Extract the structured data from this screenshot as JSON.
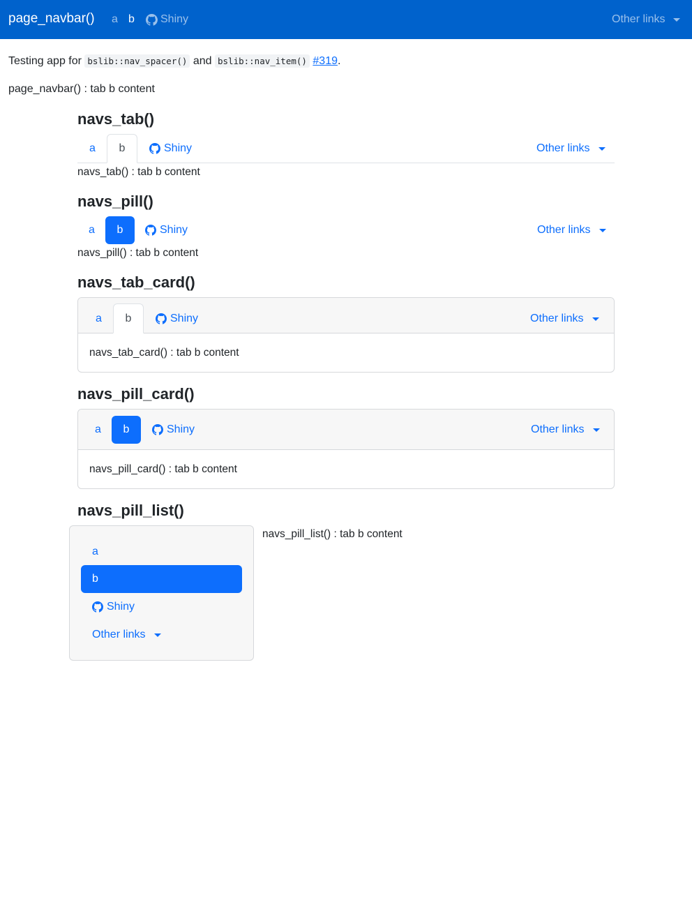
{
  "navbar": {
    "title": "page_navbar()",
    "items": [
      "a",
      "b"
    ],
    "shiny_label": "Shiny",
    "other_links": "Other links"
  },
  "intro": {
    "prefix": "Testing app for ",
    "code1": "bslib::nav_spacer()",
    "and": " and ",
    "code2": "bslib::nav_item()",
    "issue": "#319",
    "suffix": "."
  },
  "page_content": "page_navbar() : tab b content",
  "sections": {
    "tab": {
      "heading": "navs_tab()",
      "items": [
        "a",
        "b"
      ],
      "shiny_label": "Shiny",
      "other_links": "Other links",
      "content": "navs_tab() : tab b content"
    },
    "pill": {
      "heading": "navs_pill()",
      "items": [
        "a",
        "b"
      ],
      "shiny_label": "Shiny",
      "other_links": "Other links",
      "content": "navs_pill() : tab b content"
    },
    "tab_card": {
      "heading": "navs_tab_card()",
      "items": [
        "a",
        "b"
      ],
      "shiny_label": "Shiny",
      "other_links": "Other links",
      "content": "navs_tab_card() : tab b content"
    },
    "pill_card": {
      "heading": "navs_pill_card()",
      "items": [
        "a",
        "b"
      ],
      "shiny_label": "Shiny",
      "other_links": "Other links",
      "content": "navs_pill_card() : tab b content"
    },
    "pill_list": {
      "heading": "navs_pill_list()",
      "items": [
        "a",
        "b"
      ],
      "shiny_label": "Shiny",
      "other_links": "Other links",
      "content": "navs_pill_list() : tab b content"
    }
  },
  "colors": {
    "navbar_bg": "#0062cc",
    "accent": "#0d6efd",
    "card_header_bg": "#f7f7f7"
  },
  "icons": {
    "github": "github-icon",
    "caret": "caret-down-icon"
  }
}
